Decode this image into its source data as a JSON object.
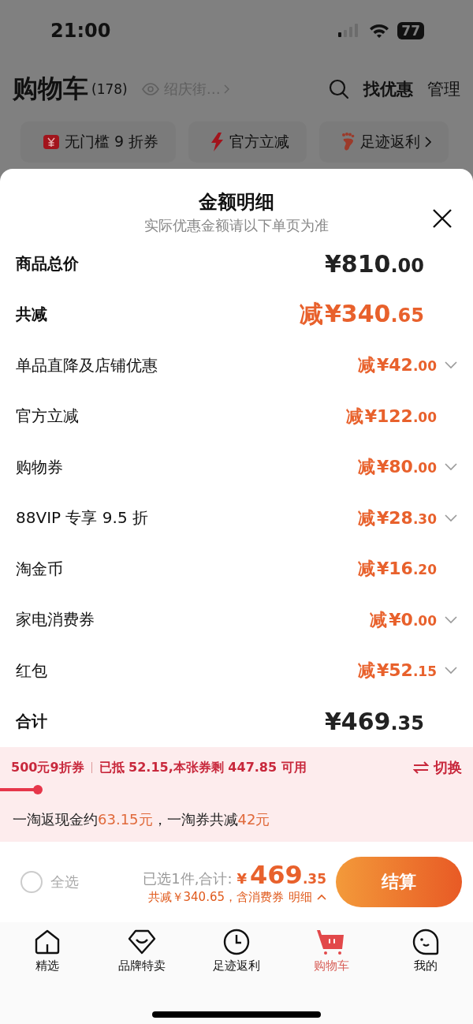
{
  "status_bar": {
    "time": "21:00",
    "battery": "77"
  },
  "header": {
    "title": "购物车",
    "count": "(178)",
    "location": "绍庆街…",
    "actions": [
      "找优惠",
      "管理"
    ]
  },
  "chips": [
    {
      "label": "无门槛 9 折券",
      "more": false
    },
    {
      "label": "官方立减",
      "more": false
    },
    {
      "label": "足迹返利",
      "more": true
    }
  ],
  "sheet": {
    "title": "金额明细",
    "subtitle": "实际优惠金额请以下单页为准",
    "rows": [
      {
        "kind": "total",
        "label": "商品总价",
        "prefix": "",
        "amount": "¥810",
        "cents": ".00",
        "expandable": false
      },
      {
        "kind": "discount",
        "label": "共减",
        "prefix": "减",
        "amount": "¥340",
        "cents": ".65",
        "expandable": false
      },
      {
        "kind": "item",
        "label": "单品直降及店铺优惠",
        "prefix": "减",
        "amount": "¥42",
        "cents": ".00",
        "expandable": true
      },
      {
        "kind": "item",
        "label": "官方立减",
        "prefix": "减",
        "amount": "¥122",
        "cents": ".00",
        "expandable": false
      },
      {
        "kind": "item",
        "label": "购物券",
        "prefix": "减",
        "amount": "¥80",
        "cents": ".00",
        "expandable": true
      },
      {
        "kind": "item",
        "label": "88VIP 专享 9.5 折",
        "prefix": "减",
        "amount": "¥28",
        "cents": ".30",
        "expandable": true
      },
      {
        "kind": "item",
        "label": "淘金币",
        "prefix": "减",
        "amount": "¥16",
        "cents": ".20",
        "expandable": false
      },
      {
        "kind": "item",
        "label": "家电消费券",
        "prefix": "减",
        "amount": "¥0",
        "cents": ".00",
        "expandable": true
      },
      {
        "kind": "item",
        "label": "红包",
        "prefix": "减",
        "amount": "¥52",
        "cents": ".15",
        "expandable": true
      },
      {
        "kind": "total",
        "label": "合计",
        "prefix": "",
        "amount": "¥469",
        "cents": ".35",
        "expandable": false
      }
    ]
  },
  "coupon": {
    "name": "500元9折券",
    "detail": "已抵 52.15,本张券剩 447.85 可用",
    "switch": "切换",
    "level": 0.09,
    "rebate": [
      {
        "text": "一淘返现金约",
        "highlight": false
      },
      {
        "text": "63.15元",
        "highlight": true
      },
      {
        "text": "，一淘券共减",
        "highlight": false
      },
      {
        "text": "42元",
        "highlight": true
      }
    ]
  },
  "checkout": {
    "select_all": "全选",
    "checked": false,
    "selected_text": "已选1件,合计:",
    "currency": "¥",
    "total": "469",
    "cents": ".35",
    "saving": "共减￥340.65，含消费券",
    "detail_link": "明细",
    "button": "结算"
  },
  "tabs": [
    {
      "label": "精选",
      "selected": false
    },
    {
      "label": "品牌特卖",
      "selected": false
    },
    {
      "label": "足迹返利",
      "selected": false
    },
    {
      "label": "购物车",
      "selected": true
    },
    {
      "label": "我的",
      "selected": false
    }
  ]
}
